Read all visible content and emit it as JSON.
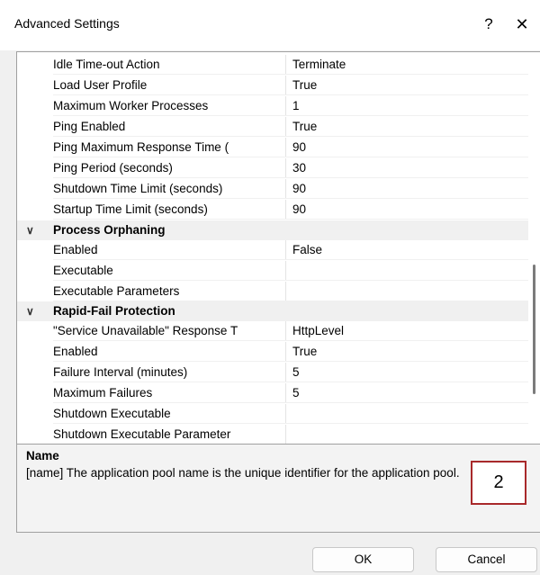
{
  "window": {
    "title": "Advanced Settings",
    "help_label": "?",
    "close_label": "✕"
  },
  "properties": {
    "pre_rows": [
      {
        "name": "Idle Time-out Action",
        "value": "Terminate"
      },
      {
        "name": "Load User Profile",
        "value": "True"
      },
      {
        "name": "Maximum Worker Processes",
        "value": "1"
      },
      {
        "name": "Ping Enabled",
        "value": "True"
      },
      {
        "name": "Ping Maximum Response Time (",
        "value": "90"
      },
      {
        "name": "Ping Period (seconds)",
        "value": "30"
      },
      {
        "name": "Shutdown Time Limit (seconds)",
        "value": "90"
      },
      {
        "name": "Startup Time Limit (seconds)",
        "value": "90"
      }
    ],
    "process_orphaning": {
      "label": "Process Orphaning",
      "chevron": "∨",
      "rows": [
        {
          "name": "Enabled",
          "value": "False"
        },
        {
          "name": "Executable",
          "value": ""
        },
        {
          "name": "Executable Parameters",
          "value": ""
        }
      ]
    },
    "rapid_fail": {
      "label": "Rapid-Fail Protection",
      "chevron": "∨",
      "rows": [
        {
          "name": "\"Service Unavailable\" Response T",
          "value": "HttpLevel"
        },
        {
          "name": "Enabled",
          "value": "True"
        },
        {
          "name": "Failure Interval (minutes)",
          "value": "5"
        },
        {
          "name": "Maximum Failures",
          "value": "5"
        },
        {
          "name": "Shutdown Executable",
          "value": ""
        },
        {
          "name": "Shutdown Executable Parameter",
          "value": ""
        }
      ]
    }
  },
  "description": {
    "title": "Name",
    "text": "[name] The application pool name is the unique identifier for the application pool."
  },
  "annotation": {
    "label": "2",
    "color": "#a8292b"
  },
  "buttons": {
    "ok": "OK",
    "cancel": "Cancel"
  }
}
